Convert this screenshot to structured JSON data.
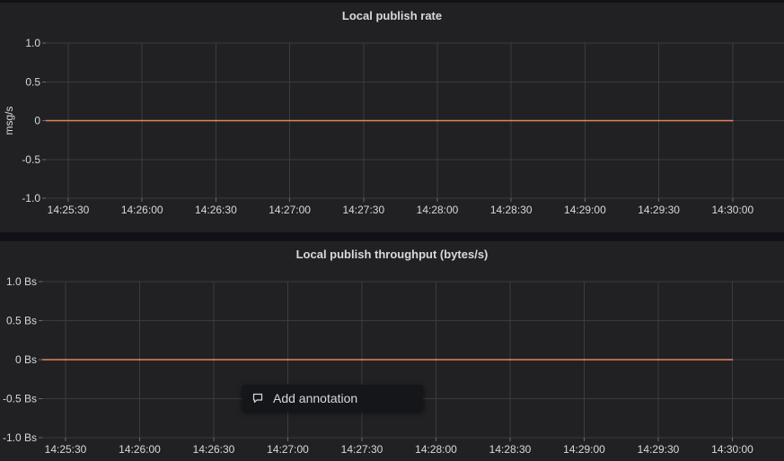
{
  "panels": [
    {
      "title": "Local publish rate",
      "chart_data": {
        "type": "line",
        "title": "Local publish rate",
        "ylabel": "msg/s",
        "xlabel": "",
        "ylim": [
          -1.0,
          1.0
        ],
        "yticks": [
          "1.0",
          "0.5",
          "0",
          "-0.5",
          "-1.0"
        ],
        "categories": [
          "14:25:30",
          "14:26:00",
          "14:26:30",
          "14:27:00",
          "14:27:30",
          "14:28:00",
          "14:28:30",
          "14:29:00",
          "14:29:30",
          "14:30:00"
        ],
        "series": [
          {
            "color": "#e0875a",
            "values": [
              0,
              0,
              0,
              0,
              0,
              0,
              0,
              0,
              0,
              0
            ]
          }
        ],
        "grid": true
      }
    },
    {
      "title": "Local publish throughput (bytes/s)",
      "chart_data": {
        "type": "line",
        "title": "Local publish throughput (bytes/s)",
        "ylabel": "",
        "xlabel": "",
        "ylim": [
          -1.0,
          1.0
        ],
        "yticks": [
          "1.0 Bs",
          "0.5 Bs",
          "0 Bs",
          "-0.5 Bs",
          "-1.0 Bs"
        ],
        "categories": [
          "14:25:30",
          "14:26:00",
          "14:26:30",
          "14:27:00",
          "14:27:30",
          "14:28:00",
          "14:28:30",
          "14:29:00",
          "14:29:30",
          "14:30:00"
        ],
        "series": [
          {
            "color": "#e0875a",
            "values": [
              0,
              0,
              0,
              0,
              0,
              0,
              0,
              0,
              0,
              0
            ]
          }
        ],
        "grid": true
      }
    }
  ],
  "context_menu": {
    "add_annotation_label": "Add annotation",
    "icon": "comment-icon"
  },
  "colors": {
    "background": "#111217",
    "panel": "#212124",
    "series": "#e0875a"
  }
}
